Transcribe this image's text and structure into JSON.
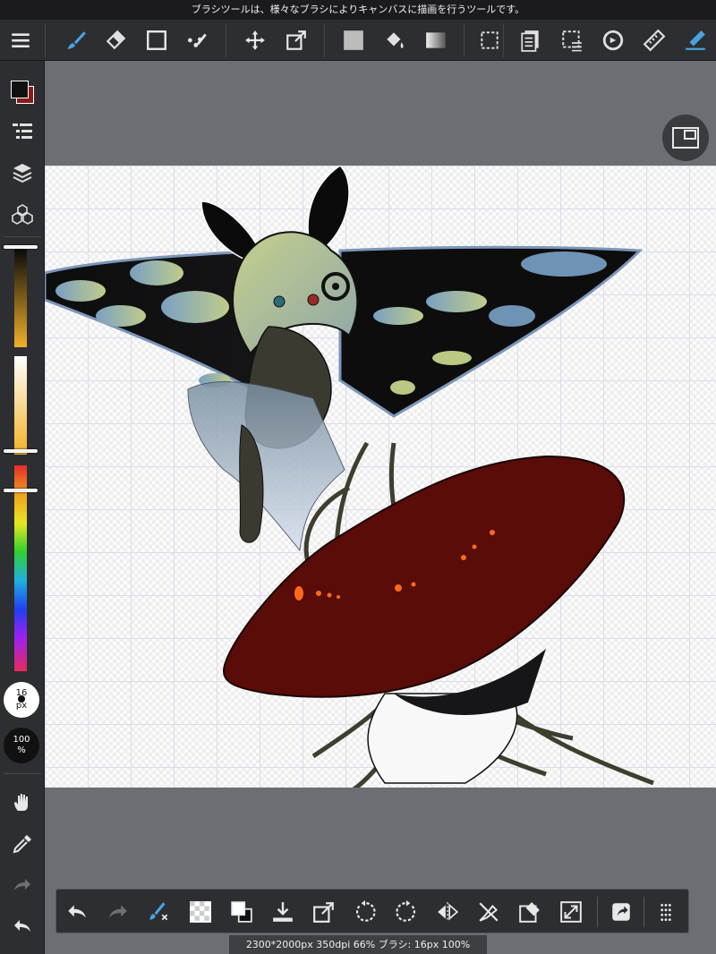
{
  "tooltip": "ブラシツールは、様々なブラシによりキャンバスに描画を行うツールです。",
  "toolbar": {
    "tools": [
      {
        "name": "menu-icon"
      },
      {
        "name": "brush-tool-icon"
      },
      {
        "name": "eraser-tool-icon"
      },
      {
        "name": "shape-tool-icon"
      },
      {
        "name": "dot-tool-icon"
      },
      {
        "name": "move-tool-icon"
      },
      {
        "name": "transform-tool-icon"
      },
      {
        "name": "fill-color-icon"
      },
      {
        "name": "bucket-tool-icon"
      },
      {
        "name": "gradient-tool-icon"
      },
      {
        "name": "select-tool-icon"
      },
      {
        "name": "layer-menu-icon"
      },
      {
        "name": "selection-menu-icon"
      },
      {
        "name": "rotate-canvas-icon"
      },
      {
        "name": "ruler-icon"
      },
      {
        "name": "snap-icon"
      }
    ]
  },
  "sidebar": {
    "foreground_color": "#111111",
    "background_color": "#8a1a1a",
    "brush_size": "16",
    "brush_size_unit": "px",
    "opacity": "100",
    "opacity_unit": "%"
  },
  "canvas": {
    "cap_color": "#5a0c08",
    "spot_color": "#ff6a1a",
    "wing_color": "#0d0d0e",
    "wing_spot_color": "#6f93b5",
    "body_color": "#b9c882"
  },
  "bottom_bar": {
    "tools": [
      "undo",
      "redo",
      "brush-settings",
      "transparency",
      "color-swap",
      "import",
      "export",
      "rotate-left",
      "rotate-right",
      "flip",
      "snap-off",
      "clear",
      "fullscreen",
      "share",
      "grid"
    ]
  },
  "status": "2300*2000px 350dpi 66% ブラシ: 16px 100%"
}
